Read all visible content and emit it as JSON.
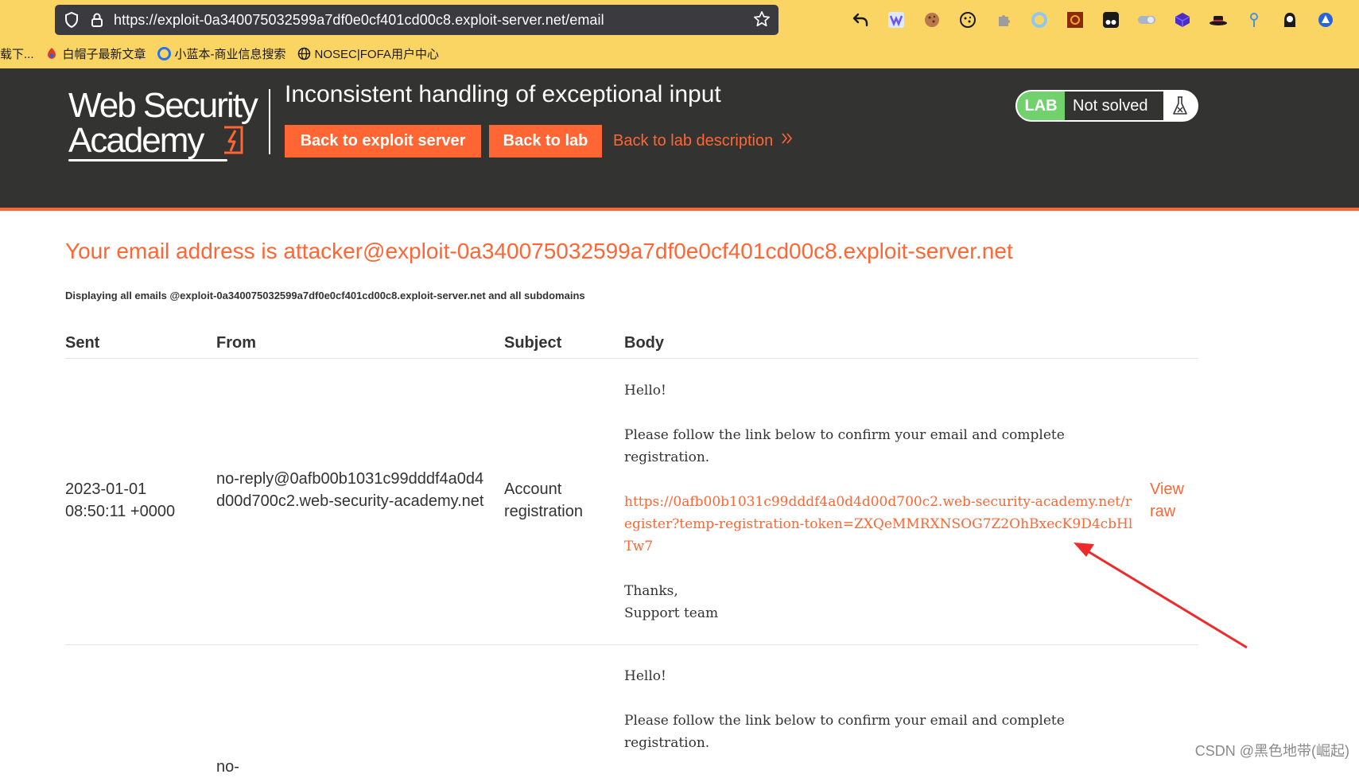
{
  "browser": {
    "url": "https://exploit-0a340075032599a7df0e0cf401cd00c8.exploit-server.net/email",
    "bookmarks": [
      {
        "label": "载下..."
      },
      {
        "label": "白帽子最新文章"
      },
      {
        "label": "小蓝本-商业信息搜索"
      },
      {
        "label": "NOSEC|FOFA用户中心"
      }
    ]
  },
  "header": {
    "logo_line1": "Web Security",
    "logo_line2": "Academy",
    "lab_title": "Inconsistent handling of exceptional input",
    "back_exploit_label": "Back to exploit server",
    "back_lab_label": "Back to lab",
    "back_description_label": "Back to lab description",
    "lab_badge": "LAB",
    "lab_status": "Not solved"
  },
  "content": {
    "email_heading": "Your email address is attacker@exploit-0a340075032599a7df0e0cf401cd00c8.exploit-server.net",
    "displaying": "Displaying all emails @exploit-0a340075032599a7df0e0cf401cd00c8.exploit-server.net and all subdomains",
    "columns": {
      "sent": "Sent",
      "from": "From",
      "subject": "Subject",
      "body": "Body"
    },
    "emails": [
      {
        "sent": "2023-01-01 08:50:11 +0000",
        "from": "no-reply@0afb00b1031c99dddf4a0d4d00d700c2.web-security-academy.net",
        "subject": "Account registration",
        "body_greeting": "Hello!",
        "body_text": "Please follow the link below to confirm your email and complete registration.",
        "body_link": "https://0afb00b1031c99dddf4a0d4d00d700c2.web-security-academy.net/register?temp-registration-token=ZXQeMMRXNSOG7Z2OhBxecK9D4cbHlTw7",
        "body_signoff": "Thanks,\nSupport team",
        "view_raw": "View raw"
      },
      {
        "from_partial": "no-",
        "body_greeting": "Hello!",
        "body_text": "Please follow the link below to confirm your email and complete registration."
      }
    ]
  },
  "watermark": "CSDN @黑色地带(崛起)",
  "colors": {
    "accent": "#ff6633",
    "header_bg": "#333332",
    "chrome_bg": "#fbd564",
    "lab_green": "#70d16d"
  }
}
